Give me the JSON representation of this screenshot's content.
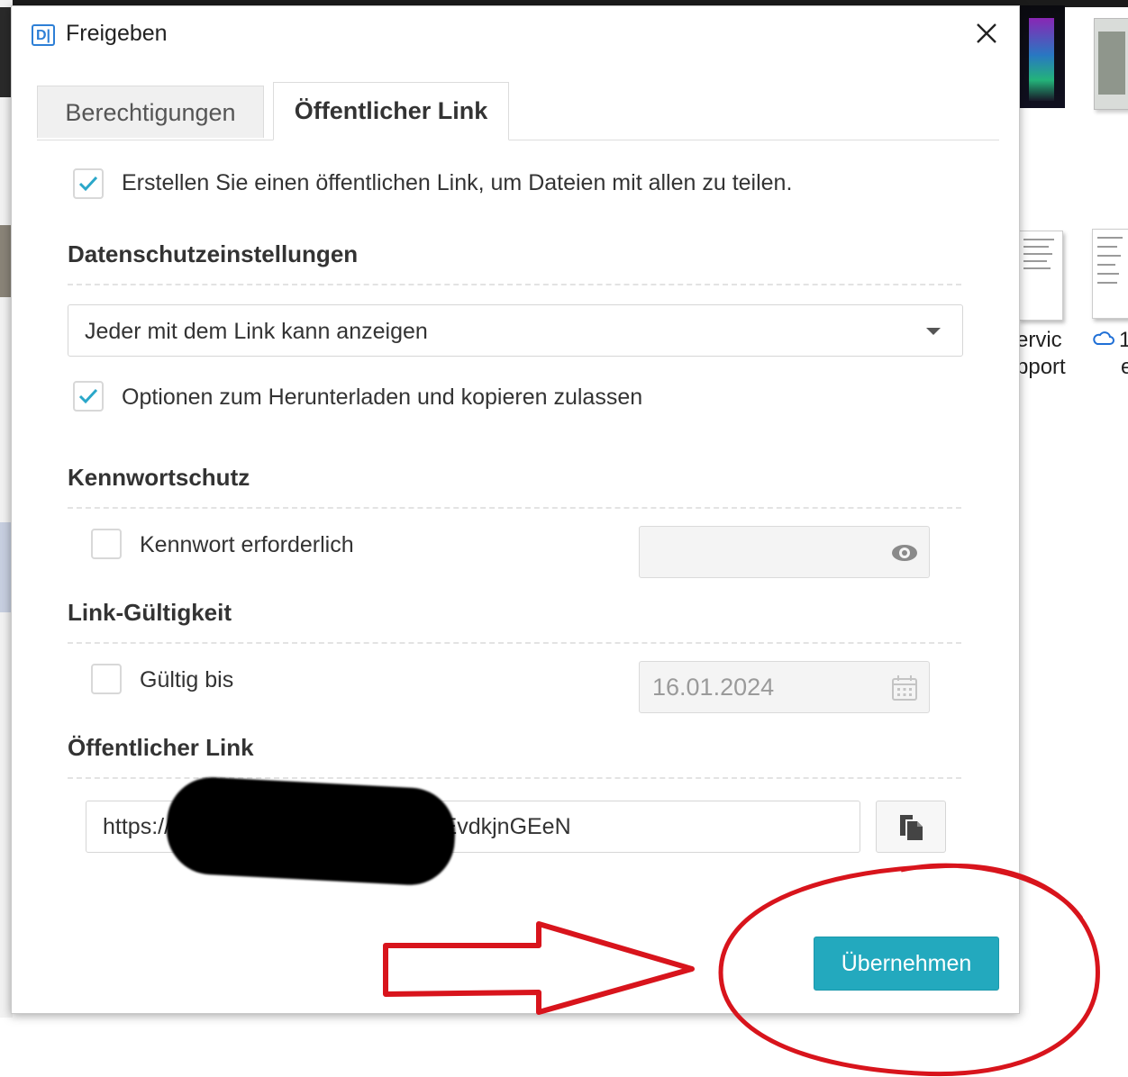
{
  "window": {
    "title": "Freigeben",
    "app_icon_text": "D|"
  },
  "tabs": [
    {
      "label": "Berechtigungen",
      "active": false
    },
    {
      "label": "Öffentlicher Link",
      "active": true
    }
  ],
  "public_link_enabled": {
    "checked": true,
    "label": "Erstellen Sie einen öffentlichen Link, um Dateien mit allen zu teilen."
  },
  "privacy": {
    "heading": "Datenschutzeinstellungen",
    "selected_option": "Jeder mit dem Link kann anzeigen",
    "allow_download": {
      "checked": true,
      "label": "Optionen zum Herunterladen und kopieren zulassen"
    }
  },
  "password": {
    "heading": "Kennwortschutz",
    "required": {
      "checked": false,
      "label": "Kennwort erforderlich"
    },
    "value": ""
  },
  "validity": {
    "heading": "Link-Gültigkeit",
    "valid_until": {
      "checked": false,
      "label": "Gültig bis"
    },
    "date": "16.01.2024"
  },
  "public_link": {
    "heading": "Öffentlicher Link",
    "url_visible": "https://                              1/d/s/qxX1M5kMUutpmm8EvdkjnGEeN"
  },
  "buttons": {
    "apply": "Übernehmen"
  },
  "background": {
    "fragments": [
      "ervic",
      "pport",
      "1",
      "e"
    ]
  },
  "colors": {
    "accent": "#23a9be",
    "check": "#2aa7c9",
    "annotation_red": "#d8141c"
  }
}
